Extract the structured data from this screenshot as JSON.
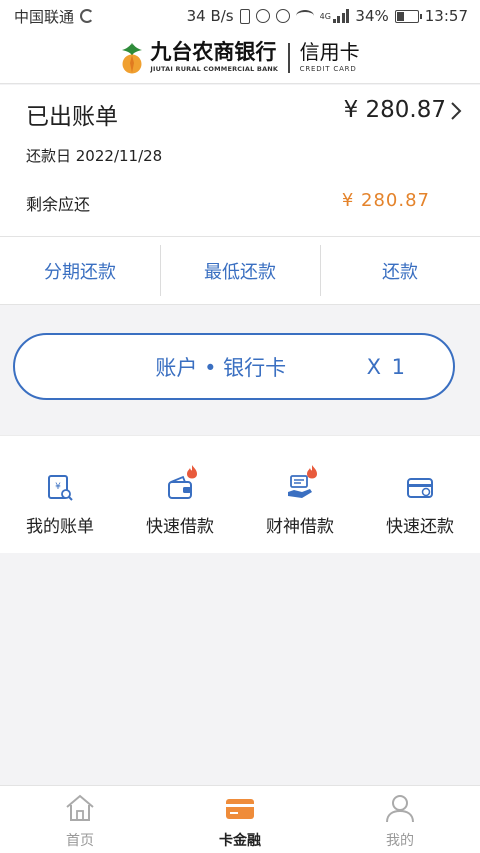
{
  "status_bar": {
    "carrier": "中国联通",
    "net_speed": "34 B/s",
    "network": "4G",
    "battery": "34%",
    "time": "13:57"
  },
  "brand": {
    "bank_name_cn": "九台农商银行",
    "bank_name_en": "JIUTAI RURAL COMMERCIAL BANK",
    "product_cn": "信用卡",
    "product_en": "CREDIT CARD"
  },
  "bill": {
    "title": "已出账单",
    "amount": "¥ 280.87",
    "due_date": "还款日 2022/11/28",
    "remaining_label": "剩余应还",
    "remaining_amount": "¥ 280.87"
  },
  "actions": {
    "installment": "分期还款",
    "minimum": "最低还款",
    "repay": "还款"
  },
  "account": {
    "label": "账户 • 银行卡",
    "count": "X 1"
  },
  "features": [
    {
      "label": "我的账单",
      "icon": "bill-icon",
      "hot": false
    },
    {
      "label": "快速借款",
      "icon": "wallet-icon",
      "hot": true
    },
    {
      "label": "财神借款",
      "icon": "cash-hand-icon",
      "hot": true
    },
    {
      "label": "快速还款",
      "icon": "card-icon",
      "hot": false
    }
  ],
  "bottom_nav": [
    {
      "label": "首页",
      "icon": "home-icon",
      "active": false
    },
    {
      "label": "卡金融",
      "icon": "card-finance-icon",
      "active": true
    },
    {
      "label": "我的",
      "icon": "user-icon",
      "active": false
    }
  ],
  "colors": {
    "accent_blue": "#3a6fc1",
    "amount_orange": "#e4832b",
    "nav_active": "#ef8c3a",
    "hot_red": "#e85a3c"
  }
}
